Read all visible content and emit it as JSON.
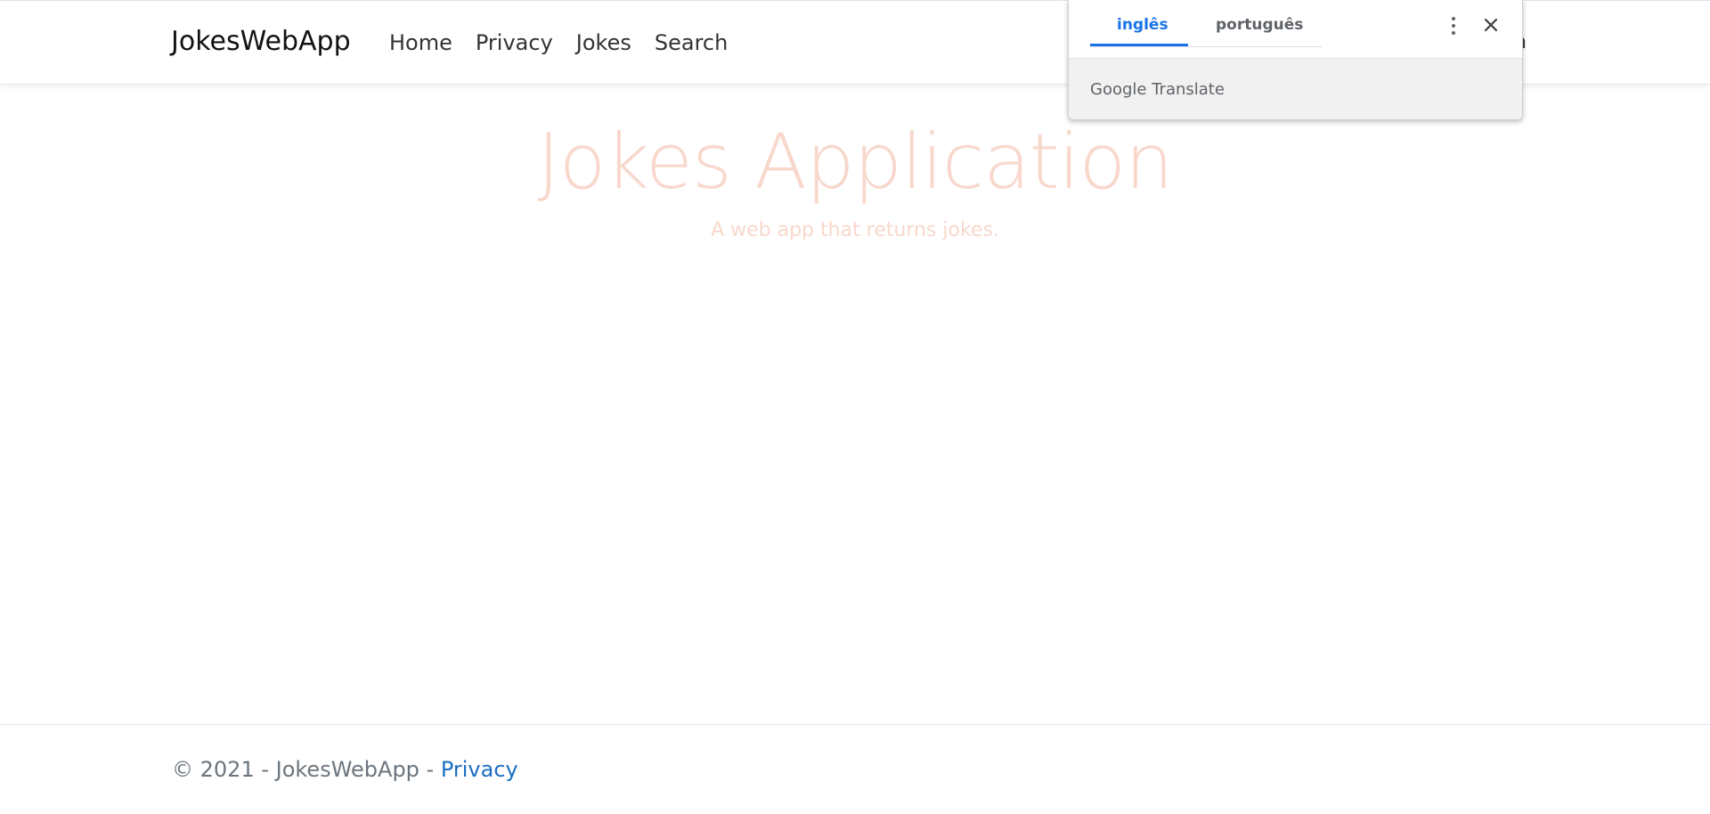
{
  "navbar": {
    "brand": "JokesWebApp",
    "links": [
      "Home",
      "Privacy",
      "Jokes",
      "Search"
    ],
    "login_stub": "n"
  },
  "hero": {
    "title": "Jokes Application",
    "subtitle": "A web app that returns jokes."
  },
  "footer": {
    "text": "© 2021 - JokesWebApp - ",
    "link": "Privacy"
  },
  "translate_popup": {
    "tabs": [
      "inglês",
      "português"
    ],
    "active_tab": "inglês",
    "brand": "Google Translate"
  },
  "colors": {
    "accent": "#1a73e8",
    "hero_text": "#f8d8cc",
    "footer_link": "#1b6ec2"
  }
}
